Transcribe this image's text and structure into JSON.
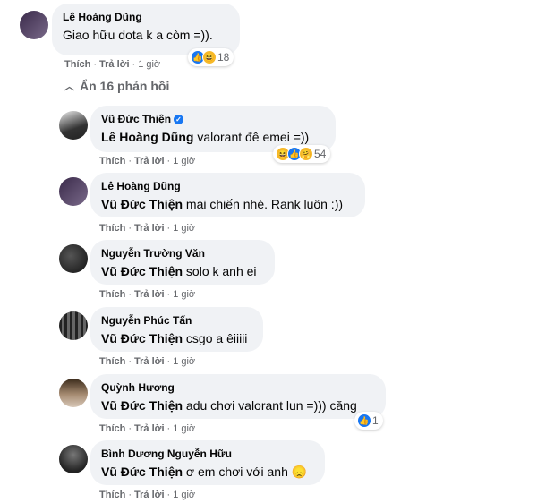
{
  "top_comment": {
    "author": "Lê Hoàng Dũng",
    "text": "Giao hữu dota k a còm =)).",
    "like": "Thích",
    "reply": "Trả lời",
    "time": "1 giờ",
    "reaction_count": "18"
  },
  "hide_replies": "Ẩn 16 phản hồi",
  "replies": [
    {
      "author": "Vũ Đức Thiện",
      "tag": "Lê Hoàng Dũng",
      "text": " valorant đê emei =))",
      "like": "Thích",
      "reply": "Trả lời",
      "time": "1 giờ",
      "reaction_count": "54"
    },
    {
      "author": "Lê Hoàng Dũng",
      "tag": "Vũ Đức Thiện",
      "text": " mai chiến nhé. Rank luôn :))",
      "like": "Thích",
      "reply": "Trả lời",
      "time": "1 giờ"
    },
    {
      "author": "Nguyễn Trường Văn",
      "tag": "Vũ Đức Thiện",
      "text": " solo k anh ei",
      "like": "Thích",
      "reply": "Trả lời",
      "time": "1 giờ"
    },
    {
      "author": "Nguyễn Phúc Tấn",
      "tag": "Vũ Đức Thiện",
      "text": " csgo a êiiiii",
      "like": "Thích",
      "reply": "Trả lời",
      "time": "1 giờ"
    },
    {
      "author": "Quỳnh Hương",
      "tag": "Vũ Đức Thiện",
      "text": " adu chơi valorant lun =))) căng",
      "like": "Thích",
      "reply": "Trả lời",
      "time": "1 giờ",
      "reaction_count": "1"
    },
    {
      "author": "Bình Dương Nguyễn Hữu",
      "tag": "Vũ Đức Thiện",
      "text": " ơ em chơi với anh 😞",
      "like": "Thích",
      "reply": "Trả lời",
      "time": "1 giờ"
    }
  ],
  "colors": {
    "bubble": "#f0f2f5",
    "meta": "#65676b",
    "like_blue": "#1877f2",
    "haha_yellow": "#f7b928"
  }
}
